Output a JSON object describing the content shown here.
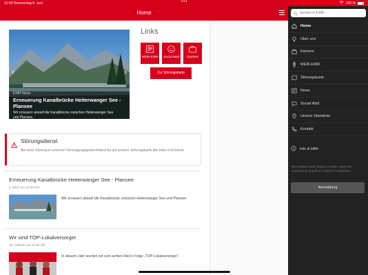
{
  "status": {
    "time_date": "12:00  Donnerstag 8. Juni",
    "dots": "•••",
    "battery": "100 %"
  },
  "header": {
    "title": "Home"
  },
  "hero": {
    "tag": "EWR News",
    "title": "Erneuerung Kanalbrücke Heiterwanger See - Plansee",
    "description": "Wir erneuern aktuell die Kanalbrücke zwischen Heiterwanger See und Plansee.",
    "prev": "‹",
    "next": "›"
  },
  "links": {
    "title": "Links",
    "tiles": [
      {
        "label": "MEIN EWR",
        "icon": "users-icon"
      },
      {
        "label": "Social Wall",
        "icon": "smile-icon"
      },
      {
        "label": "Karriere",
        "icon": "briefcase-icon"
      }
    ],
    "button": "Zur Störungskarte"
  },
  "alert": {
    "title": "Störungsdienst",
    "text": "Bei einer Störung in unserem Versorgungsgebiet findest du auf unserer Störungskarte alle Infos in Echtzeit."
  },
  "news": [
    {
      "title": "Erneuerung Kanalbrücke Heiterwanger See - Plansee",
      "date": "2. März um 12:00 Uhr",
      "text": "Wir erneuern aktuell die Kanalbrücke zwischen Heiterwanger See und Plansee."
    },
    {
      "title": "Wir sind TOP-Lokalversorger",
      "date": "26. Februar um 12:00 Uhr",
      "text": "In diesem Jahr wurden wir zum achten Mal in Folge „TOP-Lokalversorger“."
    }
  ],
  "sidebar": {
    "search_placeholder": "Suchen in EWR",
    "items": [
      {
        "label": "Home",
        "icon": "home-icon"
      },
      {
        "label": "Über uns",
        "icon": "bulb-icon"
      },
      {
        "label": "Karriere",
        "icon": "briefcase-icon"
      },
      {
        "label": "MEIN EWR",
        "icon": "person-icon"
      },
      {
        "label": "Störungskarte",
        "icon": "map-icon"
      },
      {
        "label": "News",
        "icon": "news-icon"
      },
      {
        "label": "Social Wall",
        "icon": "chat-icon"
      },
      {
        "label": "Unsere Standorte",
        "icon": "pin-icon"
      },
      {
        "label": "Kontakt",
        "icon": "phone-icon"
      }
    ],
    "info": "Info & Hilfe",
    "hint": "Berechtigte EWR-Nutzer erhalten nach der Anmeldung Zugriff auf weitere Funktionen.",
    "login": "Anmeldung"
  },
  "colors": {
    "accent": "#d6001c",
    "sidebar_bg": "#222222"
  }
}
